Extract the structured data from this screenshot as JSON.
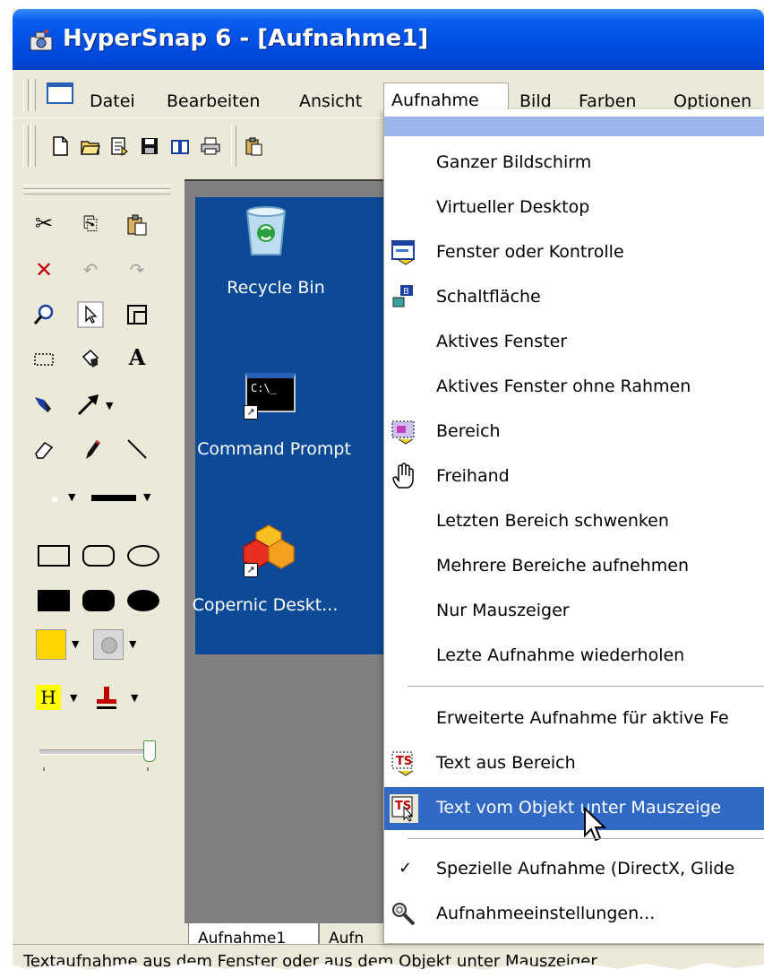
{
  "window": {
    "title": "HyperSnap 6 - [Aufnahme1]"
  },
  "menubar": {
    "items": [
      "Datei",
      "Bearbeiten",
      "Ansicht",
      "Aufnahme",
      "Bild",
      "Farben",
      "Optionen"
    ],
    "open_item": "Aufnahme"
  },
  "desktop": {
    "icons": [
      {
        "label": "Recycle Bin",
        "icon": "recycle-bin-icon"
      },
      {
        "label": "Command Prompt",
        "icon": "command-prompt-icon",
        "badge": "C:\\_"
      },
      {
        "label": "Copernic Deskt...",
        "icon": "copernic-icon"
      }
    ]
  },
  "tabs": [
    "Aufnahme1",
    "Aufn"
  ],
  "status": {
    "text": "Textaufnahme aus dem Fenster oder aus dem Objekt unter Mauszeiger"
  },
  "capture_menu": {
    "items": [
      {
        "label": "Ganzer Bildschirm"
      },
      {
        "label": "Virtueller Desktop"
      },
      {
        "label": "Fenster oder Kontrolle",
        "icon": "window-capture-icon"
      },
      {
        "label": "Schaltfläche",
        "icon": "button-capture-icon"
      },
      {
        "label": "Aktives Fenster"
      },
      {
        "label": "Aktives Fenster ohne Rahmen"
      },
      {
        "label": "Bereich",
        "icon": "region-capture-icon"
      },
      {
        "label": "Freihand",
        "icon": "hand-icon"
      },
      {
        "label": "Letzten Bereich schwenken"
      },
      {
        "label": "Mehrere Bereiche aufnehmen"
      },
      {
        "label": "Nur Mauszeiger"
      },
      {
        "label": "Lezte Aufnahme wiederholen"
      },
      {
        "label": "Erweiterte Aufnahme für aktive Fe"
      },
      {
        "label": "Text aus Bereich",
        "icon": "text-region-icon"
      },
      {
        "label": "Text vom Objekt unter Mauszeige",
        "icon": "text-object-icon",
        "highlighted": true
      },
      {
        "label": "Spezielle Aufnahme (DirectX, Glide",
        "checked": true
      },
      {
        "label": "Aufnahmeeinstellungen...",
        "icon": "settings-icon"
      }
    ]
  },
  "colors": {
    "titlebar": "#0050e6",
    "highlight": "#316ac5",
    "desktop": "#0c4a97",
    "menu_strip": "#9cb4ea",
    "face": "#ece9d8"
  }
}
